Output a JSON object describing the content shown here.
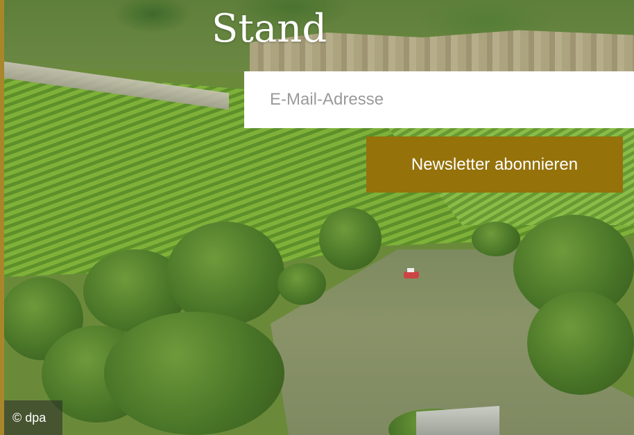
{
  "hero": {
    "headline": "Stand",
    "image_credit": "© dpa"
  },
  "newsletter": {
    "email_placeholder": "E-Mail-Adresse",
    "email_value": "",
    "subscribe_label": "Newsletter abonnieren"
  },
  "colors": {
    "button_background": "#95720a",
    "button_text": "#ffffff",
    "input_background": "#ffffff",
    "placeholder_text": "#9a9a9a",
    "headline_text": "#ffffff",
    "accent_edge": "#a8872a"
  }
}
